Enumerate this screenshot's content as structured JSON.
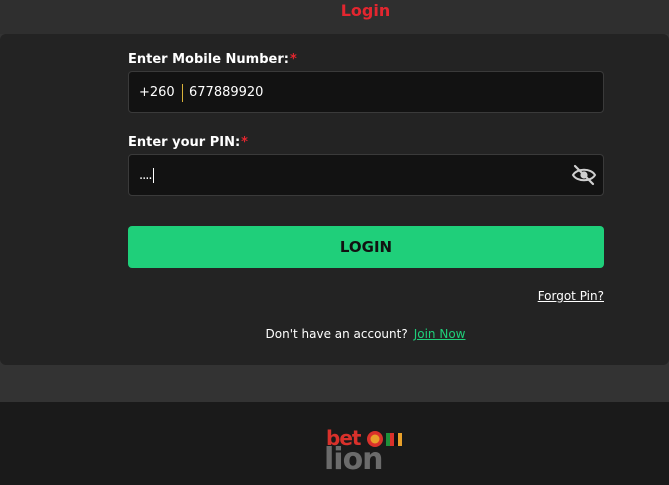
{
  "header": {
    "title": "Login"
  },
  "form": {
    "mobile": {
      "label": "Enter Mobile Number:",
      "required_mark": "*",
      "country_code": "+260",
      "value": "677889920"
    },
    "pin": {
      "label": "Enter your PIN:",
      "required_mark": "*",
      "value": "....",
      "toggle_icon": "eye-slash-icon"
    },
    "submit_label": "LOGIN",
    "forgot_label": "Forgot Pin?",
    "signup_prompt": "Don't have an account?",
    "signup_link": "Join Now"
  },
  "footer": {
    "logo_top": "bet",
    "logo_bottom": "lion"
  },
  "colors": {
    "accent_green": "#1fcf7a",
    "brand_red": "#e3262f",
    "background": "#333333",
    "card": "#232323"
  }
}
